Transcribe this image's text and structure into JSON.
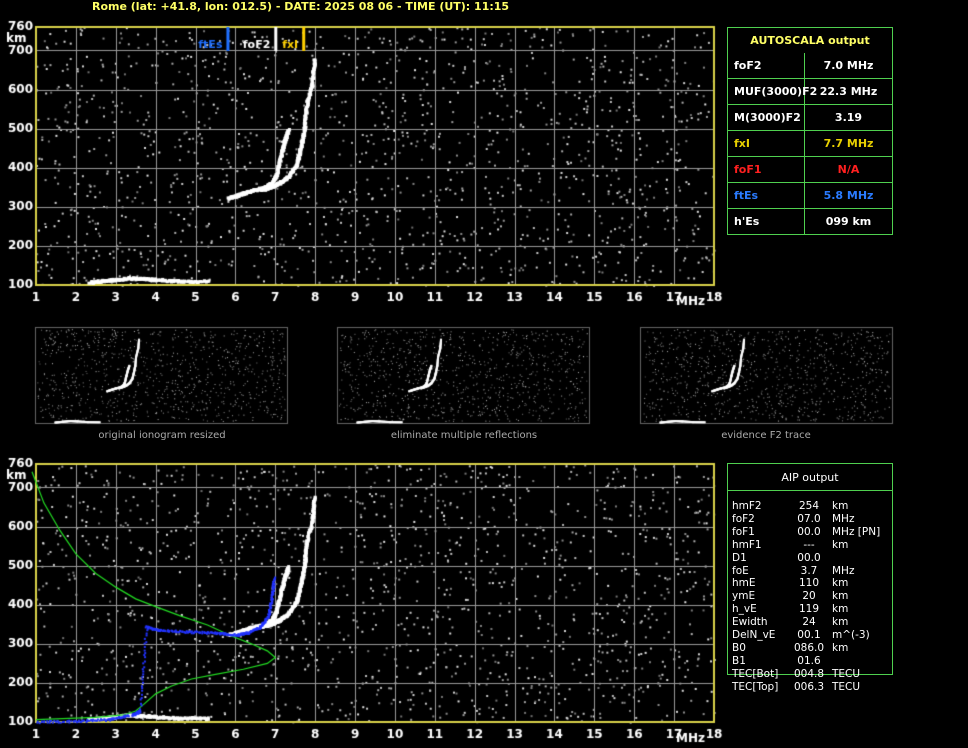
{
  "header": {
    "title": "Rome (lat: +41.8, lon: 012.5) - DATE: 2025 08 06 - TIME (UT): 11:15"
  },
  "colors": {
    "grid": "#9a9a9a",
    "frame": "#d9d24a",
    "panel_border": "#4fd04f",
    "title": "#ffff66",
    "fof2_marker": "#ffffff",
    "fxi_marker": "#ffd000",
    "ftes_marker": "#1f6fff",
    "profile": "#22dd22",
    "aip_trace": "#2233ff"
  },
  "autoscala": {
    "header": "AUTOSCALA output",
    "rows": [
      {
        "label": "foF2",
        "value": "7.0 MHz",
        "color": "#ffffff"
      },
      {
        "label": "MUF(3000)F2",
        "value": "22.3 MHz",
        "color": "#ffffff"
      },
      {
        "label": "M(3000)F2",
        "value": "3.19",
        "color": "#ffffff"
      },
      {
        "label": "fxI",
        "value": "7.7 MHz",
        "color": "#e8d000"
      },
      {
        "label": "foF1",
        "value": "N/A",
        "color": "#ff2020"
      },
      {
        "label": "ftEs",
        "value": "5.8 MHz",
        "color": "#2a7bff"
      },
      {
        "label": "h'Es",
        "value": "099   km",
        "color": "#ffffff"
      }
    ]
  },
  "aip": {
    "header": "AIP output",
    "rows": [
      {
        "k": "hmF2",
        "v": "254",
        "u": "km"
      },
      {
        "k": "foF2",
        "v": "07.0",
        "u": "MHz"
      },
      {
        "k": "foF1",
        "v": "00.0",
        "u": "MHz   [PN]"
      },
      {
        "k": "hmF1",
        "v": "---",
        "u": "km"
      },
      {
        "k": "D1",
        "v": "00.0",
        "u": ""
      },
      {
        "k": "foE",
        "v": "3.7",
        "u": "MHz"
      },
      {
        "k": "hmE",
        "v": "110",
        "u": "km"
      },
      {
        "k": "ymE",
        "v": "20",
        "u": "km"
      },
      {
        "k": "h_vE",
        "v": "119",
        "u": "km"
      },
      {
        "k": "Ewidth",
        "v": "24",
        "u": "km"
      },
      {
        "k": "DelN_vE",
        "v": "00.1",
        "u": "m^(-3)"
      },
      {
        "k": "B0",
        "v": "086.0",
        "u": "km"
      },
      {
        "k": "B1",
        "v": "01.6",
        "u": ""
      },
      {
        "k": "TEC[Bot]",
        "v": "004.8",
        "u": "TECU"
      },
      {
        "k": "TEC[Top]",
        "v": "006.3",
        "u": "TECU"
      }
    ]
  },
  "thumbnails": {
    "captions": [
      "original ionogram resized",
      "eliminate multiple reflections",
      "evidence F2 trace"
    ]
  },
  "chart_data": [
    {
      "type": "scatter",
      "xlabel": "MHz",
      "ylabel": "km",
      "xlim": [
        1,
        18
      ],
      "ylim": [
        100,
        760
      ],
      "x_ticks": [
        "1",
        "2",
        "3",
        "4",
        "5",
        "6",
        "7",
        "8",
        "9",
        "10",
        "11",
        "12",
        "13",
        "14",
        "15",
        "16",
        "17",
        "18"
      ],
      "y_ticks": [
        "100",
        "200",
        "300",
        "400",
        "500",
        "600",
        "700",
        "760"
      ],
      "markers": [
        {
          "name": "ftEs",
          "x": 5.8
        },
        {
          "name": "foF2",
          "x": 7.0
        },
        {
          "name": "fxI",
          "x": 7.7
        }
      ],
      "series": [
        {
          "name": "o-trace",
          "points": [
            [
              5.8,
              325
            ],
            [
              6.1,
              335
            ],
            [
              6.4,
              345
            ],
            [
              6.7,
              352
            ],
            [
              6.9,
              365
            ],
            [
              7.0,
              385
            ],
            [
              7.1,
              430
            ],
            [
              7.2,
              470
            ],
            [
              7.3,
              500
            ]
          ]
        },
        {
          "name": "x-trace",
          "points": [
            [
              6.6,
              345
            ],
            [
              6.9,
              355
            ],
            [
              7.1,
              365
            ],
            [
              7.3,
              380
            ],
            [
              7.5,
              410
            ],
            [
              7.6,
              450
            ],
            [
              7.7,
              500
            ],
            [
              7.75,
              560
            ],
            [
              7.9,
              620
            ],
            [
              7.95,
              680
            ]
          ]
        },
        {
          "name": "es-trace",
          "points": [
            [
              2.3,
              110
            ],
            [
              2.8,
              115
            ],
            [
              3.3,
              120
            ],
            [
              3.8,
              118
            ],
            [
              4.5,
              113
            ],
            [
              5.3,
              112
            ]
          ]
        }
      ]
    },
    {
      "type": "line",
      "xlabel": "MHz",
      "ylabel": "km",
      "xlim": [
        1,
        18
      ],
      "ylim": [
        100,
        760
      ],
      "x_ticks": [
        "1",
        "2",
        "3",
        "4",
        "5",
        "6",
        "7",
        "8",
        "9",
        "10",
        "11",
        "12",
        "13",
        "14",
        "15",
        "16",
        "17",
        "18"
      ],
      "y_ticks": [
        "100",
        "200",
        "300",
        "400",
        "500",
        "600",
        "700",
        "760"
      ],
      "series": [
        {
          "name": "profile",
          "points": [
            [
              0.9,
              740
            ],
            [
              1.2,
              660
            ],
            [
              1.6,
              590
            ],
            [
              2.0,
              530
            ],
            [
              2.5,
              480
            ],
            [
              3.0,
              445
            ],
            [
              3.5,
              415
            ],
            [
              4.0,
              395
            ],
            [
              4.6,
              372
            ],
            [
              5.3,
              348
            ],
            [
              5.9,
              320
            ],
            [
              6.4,
              300
            ],
            [
              6.8,
              282
            ],
            [
              7.0,
              265
            ],
            [
              6.8,
              250
            ],
            [
              6.2,
              235
            ],
            [
              5.5,
              222
            ],
            [
              4.9,
              210
            ],
            [
              4.4,
              192
            ],
            [
              4.0,
              172
            ],
            [
              3.7,
              145
            ],
            [
              3.5,
              128
            ],
            [
              3.2,
              118
            ],
            [
              2.5,
              112
            ],
            [
              1.5,
              108
            ],
            [
              1.0,
              106
            ]
          ]
        },
        {
          "name": "aip-trace",
          "points": [
            [
              3.4,
              120
            ],
            [
              3.6,
              130
            ],
            [
              3.75,
              345
            ],
            [
              4.1,
              337
            ],
            [
              4.8,
              332
            ],
            [
              5.5,
              330
            ],
            [
              6.0,
              325
            ],
            [
              6.3,
              330
            ],
            [
              6.6,
              345
            ],
            [
              6.8,
              370
            ],
            [
              6.9,
              420
            ],
            [
              6.95,
              470
            ]
          ]
        },
        {
          "name": "aip-e",
          "points": [
            [
              1.0,
              102
            ],
            [
              2.0,
              104
            ],
            [
              2.8,
              108
            ],
            [
              3.3,
              118
            ]
          ]
        }
      ]
    }
  ]
}
